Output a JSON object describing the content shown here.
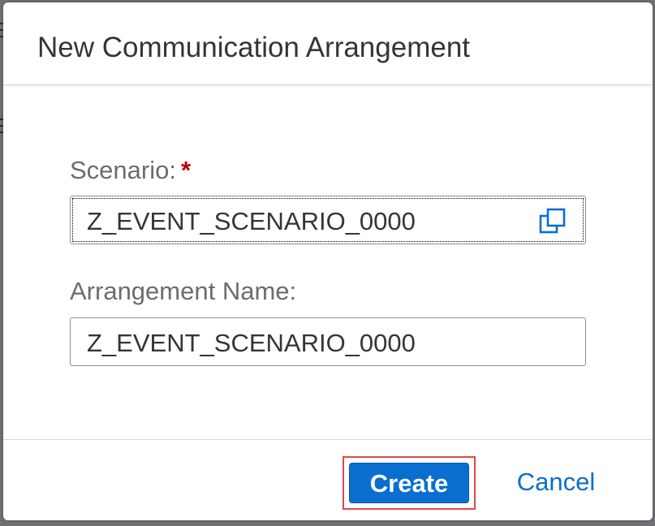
{
  "dialog": {
    "title": "New Communication Arrangement"
  },
  "form": {
    "scenario": {
      "label": "Scenario:",
      "required_marker": "*",
      "value": "Z_EVENT_SCENARIO_0000",
      "icon": "value-help-icon"
    },
    "arrangement_name": {
      "label": "Arrangement Name:",
      "value": "Z_EVENT_SCENARIO_0000"
    }
  },
  "footer": {
    "create_label": "Create",
    "cancel_label": "Cancel"
  },
  "colors": {
    "accent": "#0a6ed1",
    "required": "#bb0000",
    "highlight_outline": "#e0474f"
  }
}
